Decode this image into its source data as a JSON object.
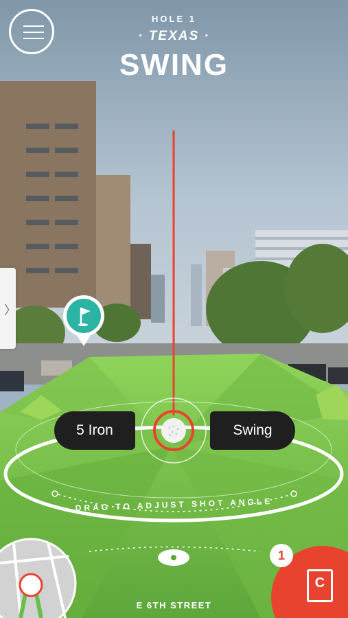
{
  "header": {
    "hole_label": "HOLE 1",
    "brand_sub": "· TEXAS ·",
    "brand_main": "SWING"
  },
  "controls": {
    "club_label": "5 Iron",
    "swing_label": "Swing",
    "instruction": "DRAG TO ADJUST SHOT ANGLE"
  },
  "location": {
    "street_name": "E 6TH STREET"
  },
  "card_button": {
    "badge_count": "1",
    "icon_letter": "C"
  },
  "colors": {
    "accent": "#e8432e",
    "grass": "#7cc04b",
    "flag_marker": "#2bb3a3",
    "pill": "#1f1f1f"
  },
  "icons": [
    "menu-icon",
    "chevron-right-icon",
    "flag-icon",
    "golf-ball-icon",
    "card-icon",
    "minimap-icon"
  ]
}
